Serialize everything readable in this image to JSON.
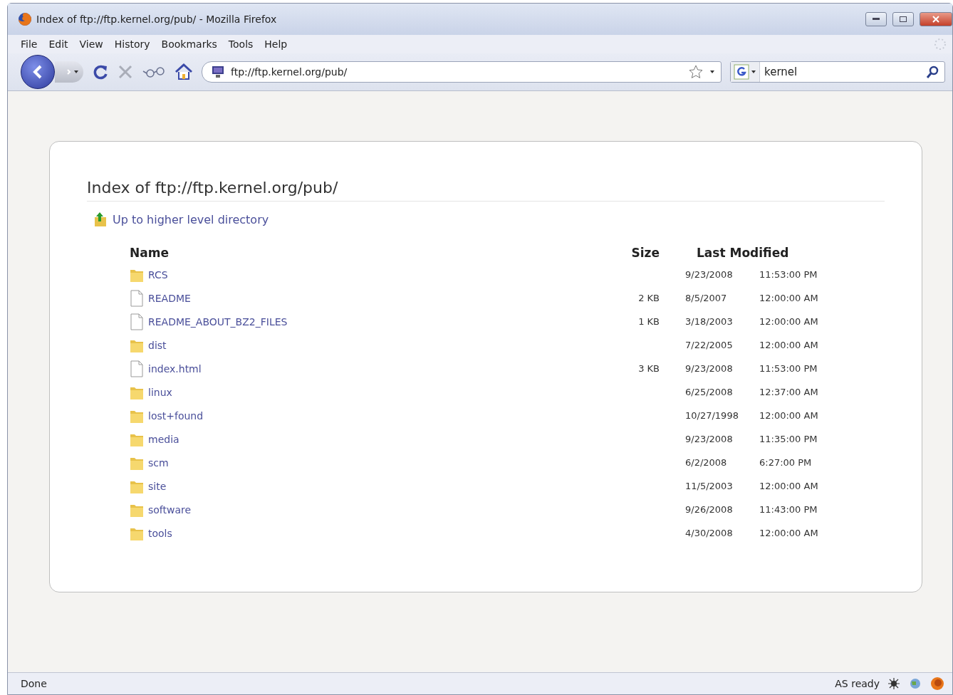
{
  "window": {
    "title": "Index of ftp://ftp.kernel.org/pub/ - Mozilla Firefox"
  },
  "menu": [
    "File",
    "Edit",
    "View",
    "History",
    "Bookmarks",
    "Tools",
    "Help"
  ],
  "address": {
    "value": "ftp://ftp.kernel.org/pub/"
  },
  "search": {
    "value": "kernel"
  },
  "page": {
    "heading": "Index of ftp://ftp.kernel.org/pub/",
    "up_link": "Up to higher level directory",
    "columns": [
      "Name",
      "Size",
      "Last Modified"
    ],
    "rows": [
      {
        "kind": "folder",
        "name": "RCS",
        "date": "9/23/2008",
        "time": "11:53:00 PM"
      },
      {
        "kind": "file",
        "name": "README",
        "size": "2 KB",
        "date": "8/5/2007",
        "time": "12:00:00 AM"
      },
      {
        "kind": "file",
        "name": "README_ABOUT_BZ2_FILES",
        "size": "1 KB",
        "date": "3/18/2003",
        "time": "12:00:00 AM"
      },
      {
        "kind": "folder",
        "name": "dist",
        "date": "7/22/2005",
        "time": "12:00:00 AM"
      },
      {
        "kind": "file",
        "name": "index.html",
        "size": "3 KB",
        "date": "9/23/2008",
        "time": "11:53:00 PM"
      },
      {
        "kind": "folder",
        "name": "linux",
        "date": "6/25/2008",
        "time": "12:37:00 AM"
      },
      {
        "kind": "folder",
        "name": "lost+found",
        "date": "10/27/1998",
        "time": "12:00:00 AM"
      },
      {
        "kind": "folder",
        "name": "media",
        "date": "9/23/2008",
        "time": "11:35:00 PM"
      },
      {
        "kind": "folder",
        "name": "scm",
        "date": "6/2/2008",
        "time": "6:27:00 PM"
      },
      {
        "kind": "folder",
        "name": "site",
        "date": "11/5/2003",
        "time": "12:00:00 AM"
      },
      {
        "kind": "folder",
        "name": "software",
        "date": "9/26/2008",
        "time": "11:43:00 PM"
      },
      {
        "kind": "folder",
        "name": "tools",
        "date": "4/30/2008",
        "time": "12:00:00 AM"
      }
    ]
  },
  "status_bar": {
    "left": "Done",
    "right": "AS ready"
  }
}
